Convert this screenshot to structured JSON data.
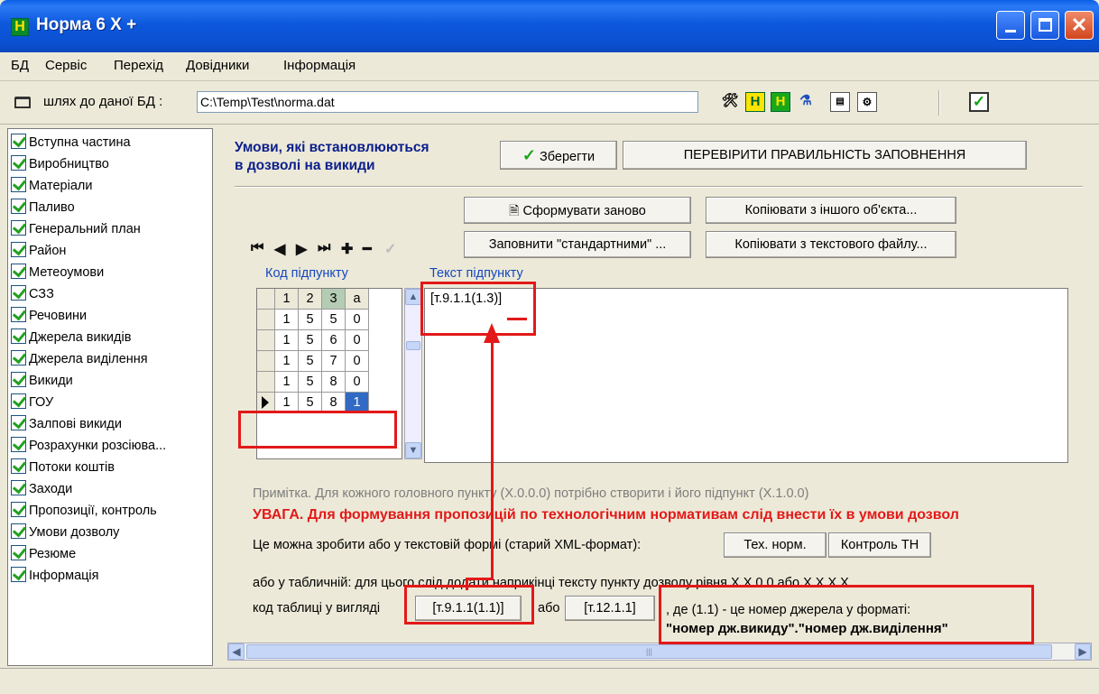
{
  "window": {
    "title": "Норма 6 X +",
    "icon_letter": "H"
  },
  "menu": [
    "БД",
    "Сервіс",
    "Перехід",
    "Довідники",
    "Інформація"
  ],
  "pathbar": {
    "label": "шлях до даної БД :",
    "value": "C:\\Temp\\Test\\norma.dat"
  },
  "toolbar_icons": [
    "tools-icon",
    "h-yellow-icon",
    "h-green-icon",
    "flask-icon",
    "report-icon",
    "settings-icon",
    "check-icon"
  ],
  "sidebar": {
    "items": [
      "Вступна частина",
      "Виробництво",
      "Матеріали",
      "Паливо",
      "Генеральний план",
      "Район",
      "Метеоумови",
      "СЗЗ",
      "Речовини",
      "Джерела викидів",
      "Джерела виділення",
      "Викиди",
      "ГОУ",
      "Залпові викиди",
      "Розрахунки розсіюва...",
      "Потоки коштів",
      "Заходи",
      "Пропозиції, контроль",
      "Умови дозволу",
      "Резюме",
      "Інформація"
    ]
  },
  "main": {
    "title_line1": "Умови, які встановлюються",
    "title_line2": "в дозволі на викиди",
    "save_label": "Зберегти",
    "check_label": "ПЕРЕВІРИТИ ПРАВИЛЬНІСТЬ ЗАПОВНЕННЯ",
    "regen_label": "Сформувати заново",
    "fill_std_label": "Заповнити \"стандартними\" ...",
    "copy_obj_label": "Копіювати з іншого об'єкта...",
    "copy_file_label": "Копіювати з текстового файлу...",
    "code_col_label": "Код підпункту",
    "text_col_label": "Текст підпункту",
    "grid": {
      "header": [
        "1",
        "2",
        "3",
        "a"
      ],
      "rows": [
        [
          "1",
          "5",
          "5",
          "0"
        ],
        [
          "1",
          "5",
          "6",
          "0"
        ],
        [
          "1",
          "5",
          "7",
          "0"
        ],
        [
          "1",
          "5",
          "8",
          "0"
        ],
        [
          "1",
          "5",
          "8",
          "1"
        ]
      ]
    },
    "text_value": "[т.9.1.1(1.3)]",
    "note": "Примітка. Для кожного головного пункту (X.0.0.0) потрібно створити і його підпункт (X.1.0.0)",
    "warning": "УВАГА. Для формування пропозицій по технологічним нормативам слід внести їх в умови дозвол",
    "form_text": "Це можна зробити або у текстовій формі (старий XML-формат):",
    "tech_btn": "Тех. норм.",
    "control_btn": "Контроль ТН",
    "table_text": "або у табличній: для цього слід додати наприкінці тексту пункту дозволу рівня X.X.0.0 або X.X.X.X",
    "code_text": "код таблиці у вигляді",
    "code_btn1": "[т.9.1.1(1.1)]",
    "or_text": "або",
    "code_btn2": "[т.12.1.1]",
    "where_text": ", де (1.1) - це номер джерела у форматі:",
    "format_text": "\"номер дж.викиду\".\"номер дж.виділення\""
  }
}
